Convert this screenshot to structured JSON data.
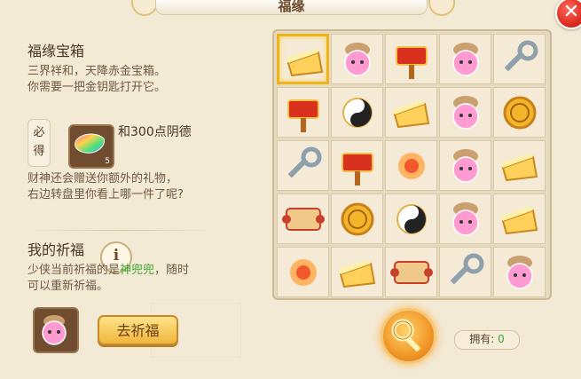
{
  "window": {
    "title": "福缘"
  },
  "left": {
    "box_title": "福缘宝箱",
    "box_desc_line1": "三界祥和，天降赤金宝箱。",
    "box_desc_line2": "你需要一把金钥匙打开它。",
    "bide_label_1": "必",
    "bide_label_2": "得",
    "reward_count": "5",
    "reward_text": "和300点阴德",
    "bonus_line1": "财神还会赠送你额外的礼物，",
    "bonus_line2": "右边转盘里你看上哪一件了呢?",
    "wish_title": "我的祈福",
    "info_icon": "i",
    "wish_desc_a": "少侠当前祈福的是",
    "wish_target": "神兜兜",
    "wish_desc_b": "，随时",
    "wish_desc_line2": "可以重新祈福。",
    "go_wish_button": "去祈福"
  },
  "grid": {
    "cells": [
      "cheese-icon",
      "pink-pet-icon",
      "red-hammer-icon",
      "pink-pet-icon",
      "silver-key-icon",
      "red-hammer-icon",
      "yinyang-icon",
      "cheese-icon",
      "pink-pet-icon",
      "gold-coin-icon",
      "silver-key-icon",
      "red-hammer-icon",
      "fire-orb-icon",
      "pink-pet-icon",
      "cheese-icon",
      "scroll-icon",
      "gold-coin-icon",
      "yinyang-icon",
      "pink-pet-icon",
      "cheese-icon",
      "fire-orb-icon",
      "cheese-icon",
      "scroll-icon",
      "silver-key-icon",
      "pink-pet-icon"
    ],
    "selected_index": 0
  },
  "footer": {
    "own_label": "拥有:",
    "own_value": "0",
    "spin_icon": "gold-key-icon"
  },
  "colors": {
    "accent": "#f0b21a",
    "highlight_text": "#3aa532",
    "close": "#d8231a"
  }
}
